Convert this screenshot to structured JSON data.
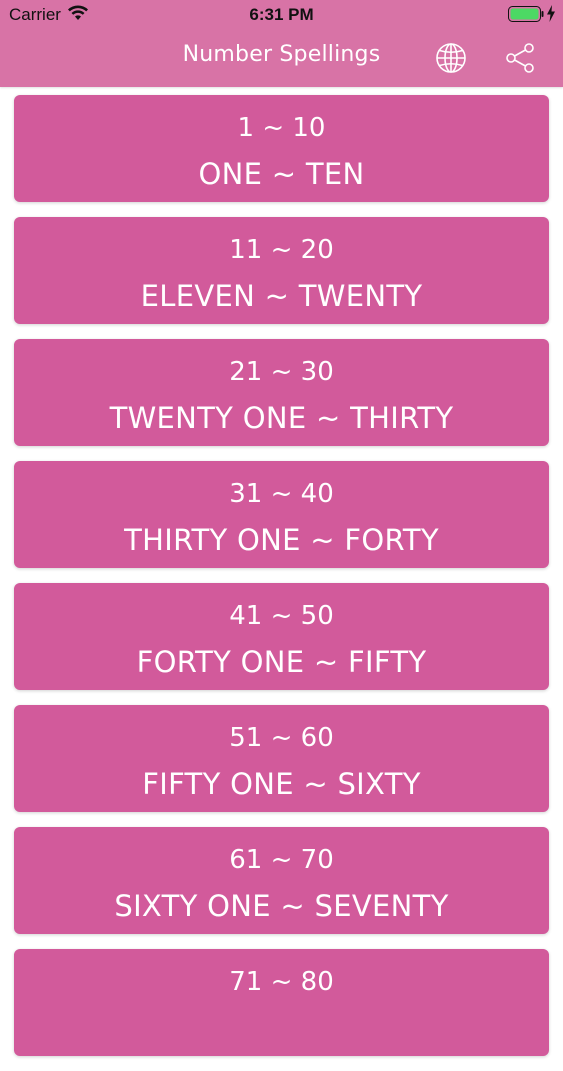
{
  "status": {
    "carrier": "Carrier",
    "time": "6:31 PM"
  },
  "nav": {
    "title": "Number Spellings",
    "globe_icon": "globe-icon",
    "share_icon": "share-icon"
  },
  "colors": {
    "header": "#d873a6",
    "card": "#d25a9b",
    "text": "#ffffff",
    "battery": "#4cd964"
  },
  "cards": [
    {
      "range": "1 ~ 10",
      "words": "ONE ~ TEN"
    },
    {
      "range": "11 ~ 20",
      "words": "ELEVEN ~ TWENTY"
    },
    {
      "range": "21 ~ 30",
      "words": "TWENTY ONE ~ THIRTY"
    },
    {
      "range": "31 ~ 40",
      "words": "THIRTY ONE ~ FORTY"
    },
    {
      "range": "41 ~ 50",
      "words": "FORTY ONE ~ FIFTY"
    },
    {
      "range": "51 ~ 60",
      "words": "FIFTY ONE ~ SIXTY"
    },
    {
      "range": "61 ~ 70",
      "words": "SIXTY ONE ~ SEVENTY"
    },
    {
      "range": "71 ~ 80",
      "words": ""
    }
  ]
}
